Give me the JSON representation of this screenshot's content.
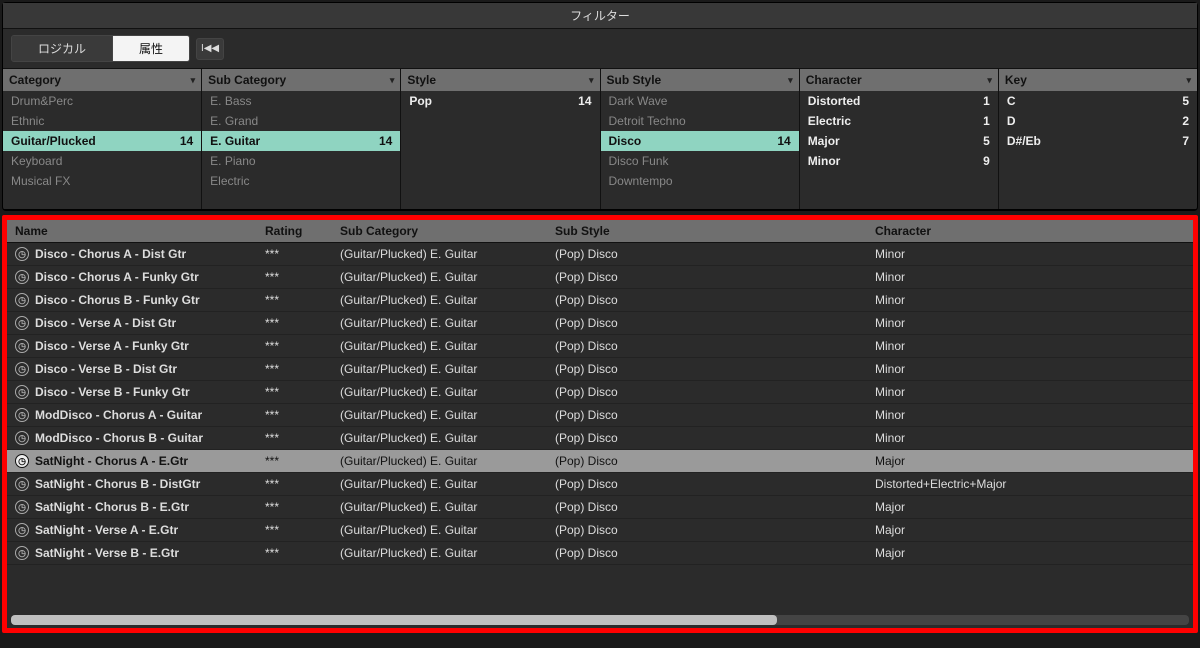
{
  "title": "フィルター",
  "tabs": {
    "logical": "ロジカル",
    "attribute": "属性"
  },
  "rewind_label": "I◀◀",
  "filters": {
    "cols": [
      {
        "head": "Category",
        "items": [
          {
            "label": "Drum&Perc",
            "count": ""
          },
          {
            "label": "Ethnic",
            "count": ""
          },
          {
            "label": "Guitar/Plucked",
            "count": "14",
            "sel": true
          },
          {
            "label": "Keyboard",
            "count": ""
          },
          {
            "label": "Musical FX",
            "count": ""
          }
        ]
      },
      {
        "head": "Sub Category",
        "items": [
          {
            "label": "E. Bass",
            "count": ""
          },
          {
            "label": "E. Grand",
            "count": ""
          },
          {
            "label": "E. Guitar",
            "count": "14",
            "sel": true
          },
          {
            "label": "E. Piano",
            "count": ""
          },
          {
            "label": "Electric",
            "count": ""
          }
        ]
      },
      {
        "head": "Style",
        "items": [
          {
            "label": "Pop",
            "count": "14",
            "bold": true
          }
        ]
      },
      {
        "head": "Sub Style",
        "items": [
          {
            "label": "Dark Wave",
            "count": ""
          },
          {
            "label": "Detroit Techno",
            "count": ""
          },
          {
            "label": "Disco",
            "count": "14",
            "sel": true
          },
          {
            "label": "Disco Funk",
            "count": ""
          },
          {
            "label": "Downtempo",
            "count": ""
          }
        ]
      },
      {
        "head": "Character",
        "items": [
          {
            "label": "Distorted",
            "count": "1",
            "bold": true
          },
          {
            "label": "Electric",
            "count": "1",
            "bold": true
          },
          {
            "label": "Major",
            "count": "5",
            "bold": true
          },
          {
            "label": "Minor",
            "count": "9",
            "bold": true
          }
        ]
      },
      {
        "head": "Key",
        "items": [
          {
            "label": "C",
            "count": "5",
            "bold": true
          },
          {
            "label": "D",
            "count": "2",
            "bold": true
          },
          {
            "label": "D#/Eb",
            "count": "7",
            "bold": true
          }
        ]
      }
    ]
  },
  "results": {
    "headers": {
      "name": "Name",
      "rating": "Rating",
      "subcat": "Sub Category",
      "substyle": "Sub Style",
      "char": "Character"
    },
    "rating_glyph": "***",
    "rows": [
      {
        "name": "Disco - Chorus A - Dist Gtr",
        "subcat": "(Guitar/Plucked) E. Guitar",
        "substyle": "(Pop) Disco",
        "char": "Minor"
      },
      {
        "name": "Disco - Chorus A - Funky Gtr",
        "subcat": "(Guitar/Plucked) E. Guitar",
        "substyle": "(Pop) Disco",
        "char": "Minor"
      },
      {
        "name": "Disco - Chorus B - Funky Gtr",
        "subcat": "(Guitar/Plucked) E. Guitar",
        "substyle": "(Pop) Disco",
        "char": "Minor"
      },
      {
        "name": "Disco - Verse A - Dist Gtr",
        "subcat": "(Guitar/Plucked) E. Guitar",
        "substyle": "(Pop) Disco",
        "char": "Minor"
      },
      {
        "name": "Disco - Verse A - Funky Gtr",
        "subcat": "(Guitar/Plucked) E. Guitar",
        "substyle": "(Pop) Disco",
        "char": "Minor"
      },
      {
        "name": "Disco - Verse B - Dist Gtr",
        "subcat": "(Guitar/Plucked) E. Guitar",
        "substyle": "(Pop) Disco",
        "char": "Minor"
      },
      {
        "name": "Disco - Verse B - Funky Gtr",
        "subcat": "(Guitar/Plucked) E. Guitar",
        "substyle": "(Pop) Disco",
        "char": "Minor"
      },
      {
        "name": "ModDisco - Chorus A - Guitar",
        "subcat": "(Guitar/Plucked) E. Guitar",
        "substyle": "(Pop) Disco",
        "char": "Minor"
      },
      {
        "name": "ModDisco - Chorus B - Guitar",
        "subcat": "(Guitar/Plucked) E. Guitar",
        "substyle": "(Pop) Disco",
        "char": "Minor"
      },
      {
        "name": "SatNight - Chorus A - E.Gtr",
        "subcat": "(Guitar/Plucked) E. Guitar",
        "substyle": "(Pop) Disco",
        "char": "Major",
        "sel": true
      },
      {
        "name": "SatNight - Chorus B - DistGtr",
        "subcat": "(Guitar/Plucked) E. Guitar",
        "substyle": "(Pop) Disco",
        "char": "Distorted+Electric+Major"
      },
      {
        "name": "SatNight - Chorus B - E.Gtr",
        "subcat": "(Guitar/Plucked) E. Guitar",
        "substyle": "(Pop) Disco",
        "char": "Major"
      },
      {
        "name": "SatNight - Verse A - E.Gtr",
        "subcat": "(Guitar/Plucked) E. Guitar",
        "substyle": "(Pop) Disco",
        "char": "Major"
      },
      {
        "name": "SatNight - Verse B - E.Gtr",
        "subcat": "(Guitar/Plucked) E. Guitar",
        "substyle": "(Pop) Disco",
        "char": "Major"
      }
    ]
  }
}
